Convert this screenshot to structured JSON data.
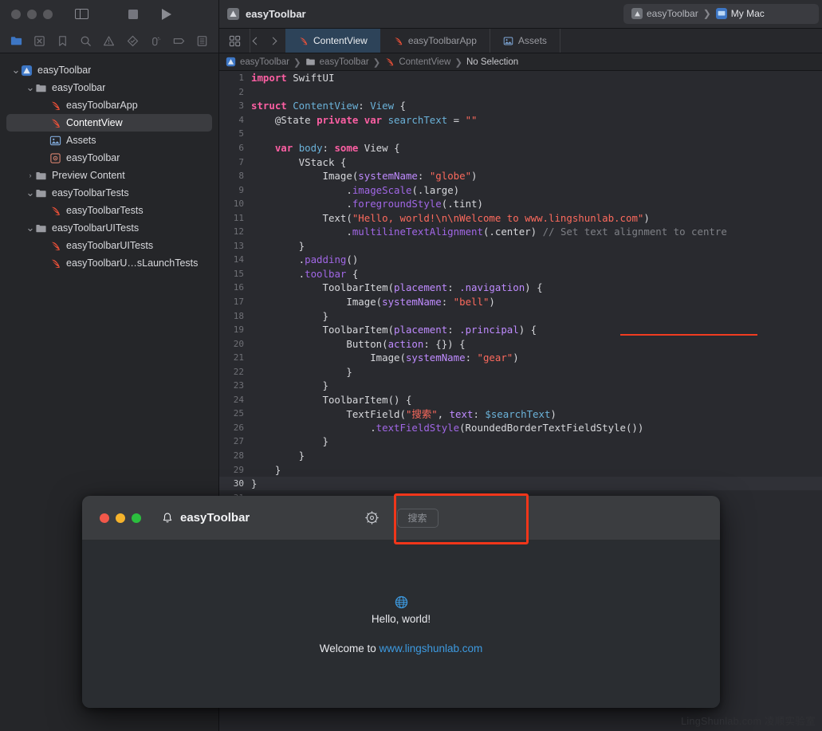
{
  "window": {
    "project_title": "easyToolbar",
    "project_icon": "xcode-app-icon",
    "sidebar_toggle_icon": "sidebar-toggle-icon",
    "stop_button_label": "stop-button",
    "run_button_label": "run-button",
    "traffic_lights": [
      "close",
      "minimize",
      "zoom"
    ]
  },
  "scheme": {
    "target": "easyToolbar",
    "separator": "❯",
    "destination": "My Mac"
  },
  "navigator_icons": [
    {
      "name": "project-navigator-icon",
      "active": true
    },
    {
      "name": "source-control-navigator-icon",
      "active": false
    },
    {
      "name": "bookmark-navigator-icon",
      "active": false
    },
    {
      "name": "find-navigator-icon",
      "active": false
    },
    {
      "name": "issue-navigator-icon",
      "active": false
    },
    {
      "name": "test-navigator-icon",
      "active": false
    },
    {
      "name": "debug-navigator-icon",
      "active": false
    },
    {
      "name": "breakpoint-navigator-icon",
      "active": false
    },
    {
      "name": "report-navigator-icon",
      "active": false
    }
  ],
  "sidebar": {
    "items": [
      {
        "label": "easyToolbar",
        "indent": 0,
        "twisty": "⌄",
        "icon": "xcode-project-icon",
        "selected": false
      },
      {
        "label": "easyToolbar",
        "indent": 1,
        "twisty": "⌄",
        "icon": "folder-icon",
        "selected": false
      },
      {
        "label": "easyToolbarApp",
        "indent": 2,
        "twisty": "",
        "icon": "swift-file-icon",
        "selected": false
      },
      {
        "label": "ContentView",
        "indent": 2,
        "twisty": "",
        "icon": "swift-file-icon",
        "selected": true
      },
      {
        "label": "Assets",
        "indent": 2,
        "twisty": "",
        "icon": "assets-catalog-icon",
        "selected": false
      },
      {
        "label": "easyToolbar",
        "indent": 2,
        "twisty": "",
        "icon": "entitlements-file-icon",
        "selected": false
      },
      {
        "label": "Preview Content",
        "indent": 1,
        "twisty": "›",
        "icon": "folder-icon",
        "selected": false
      },
      {
        "label": "easyToolbarTests",
        "indent": 1,
        "twisty": "⌄",
        "icon": "folder-icon",
        "selected": false
      },
      {
        "label": "easyToolbarTests",
        "indent": 2,
        "twisty": "",
        "icon": "swift-file-icon",
        "selected": false
      },
      {
        "label": "easyToolbarUITests",
        "indent": 1,
        "twisty": "⌄",
        "icon": "folder-icon",
        "selected": false
      },
      {
        "label": "easyToolbarUITests",
        "indent": 2,
        "twisty": "",
        "icon": "swift-file-icon",
        "selected": false
      },
      {
        "label": "easyToolbarU…sLaunchTests",
        "indent": 2,
        "twisty": "",
        "icon": "swift-file-icon",
        "selected": false
      }
    ]
  },
  "tabs": {
    "grid_icon": "tab-grid-icon",
    "back_icon": "chevron-left-icon",
    "forward_icon": "chevron-right-icon",
    "items": [
      {
        "label": "ContentView",
        "icon": "swift-file-icon",
        "active": true
      },
      {
        "label": "easyToolbarApp",
        "icon": "swift-file-icon",
        "active": false
      },
      {
        "label": "Assets",
        "icon": "assets-catalog-icon",
        "active": false
      }
    ]
  },
  "breadcrumb": {
    "items": [
      {
        "label": "easyToolbar",
        "icon": "xcode-project-icon"
      },
      {
        "label": "easyToolbar",
        "icon": "folder-icon"
      },
      {
        "label": "ContentView",
        "icon": "swift-file-icon"
      },
      {
        "label": "No Selection",
        "icon": ""
      }
    ],
    "separator": "❯"
  },
  "editor": {
    "annotation": {
      "type": "red-underline",
      "target_line": 19,
      "target_text": "placement: .principal"
    },
    "current_line": 30,
    "lines": [
      {
        "n": 1,
        "tokens": [
          {
            "t": "import ",
            "c": "kw"
          },
          {
            "t": "SwiftUI",
            "c": "pln"
          }
        ]
      },
      {
        "n": 2,
        "tokens": []
      },
      {
        "n": 3,
        "tokens": [
          {
            "t": "struct ",
            "c": "kw"
          },
          {
            "t": "ContentView",
            "c": "typ"
          },
          {
            "t": ": ",
            "c": "pln"
          },
          {
            "t": "View",
            "c": "typ"
          },
          {
            "t": " {",
            "c": "pln"
          }
        ]
      },
      {
        "n": 4,
        "tokens": [
          {
            "t": "    @State ",
            "c": "pln"
          },
          {
            "t": "private ",
            "c": "kw"
          },
          {
            "t": "var ",
            "c": "kw"
          },
          {
            "t": "searchText",
            "c": "var"
          },
          {
            "t": " = ",
            "c": "pln"
          },
          {
            "t": "\"\"",
            "c": "str"
          }
        ]
      },
      {
        "n": 5,
        "tokens": []
      },
      {
        "n": 6,
        "tokens": [
          {
            "t": "    ",
            "c": "pln"
          },
          {
            "t": "var ",
            "c": "kw"
          },
          {
            "t": "body",
            "c": "var"
          },
          {
            "t": ": ",
            "c": "pln"
          },
          {
            "t": "some ",
            "c": "kw"
          },
          {
            "t": "View",
            "c": "pln"
          },
          {
            "t": " {",
            "c": "pln"
          }
        ]
      },
      {
        "n": 7,
        "tokens": [
          {
            "t": "        VStack {",
            "c": "pln"
          }
        ]
      },
      {
        "n": 8,
        "tokens": [
          {
            "t": "            Image(",
            "c": "pln"
          },
          {
            "t": "systemName",
            "c": "prm"
          },
          {
            "t": ": ",
            "c": "pln"
          },
          {
            "t": "\"globe\"",
            "c": "str"
          },
          {
            "t": ")",
            "c": "pln"
          }
        ]
      },
      {
        "n": 9,
        "tokens": [
          {
            "t": "                .",
            "c": "pln"
          },
          {
            "t": "imageScale",
            "c": "mth"
          },
          {
            "t": "(.large)",
            "c": "pln"
          }
        ]
      },
      {
        "n": 10,
        "tokens": [
          {
            "t": "                .",
            "c": "pln"
          },
          {
            "t": "foregroundStyle",
            "c": "mth"
          },
          {
            "t": "(.tint)",
            "c": "pln"
          }
        ]
      },
      {
        "n": 11,
        "tokens": [
          {
            "t": "            Text(",
            "c": "pln"
          },
          {
            "t": "\"Hello, world!\\n\\nWelcome to www.lingshunlab.com\"",
            "c": "str"
          },
          {
            "t": ")",
            "c": "pln"
          }
        ]
      },
      {
        "n": 12,
        "tokens": [
          {
            "t": "                .",
            "c": "pln"
          },
          {
            "t": "multilineTextAlignment",
            "c": "mth"
          },
          {
            "t": "(.center) ",
            "c": "pln"
          },
          {
            "t": "// Set text alignment to centre",
            "c": "cmt"
          }
        ]
      },
      {
        "n": 13,
        "tokens": [
          {
            "t": "        }",
            "c": "pln"
          }
        ]
      },
      {
        "n": 14,
        "tokens": [
          {
            "t": "        .",
            "c": "pln"
          },
          {
            "t": "padding",
            "c": "mth"
          },
          {
            "t": "()",
            "c": "pln"
          }
        ]
      },
      {
        "n": 15,
        "tokens": [
          {
            "t": "        .",
            "c": "pln"
          },
          {
            "t": "toolbar",
            "c": "mth"
          },
          {
            "t": " {",
            "c": "pln"
          }
        ]
      },
      {
        "n": 16,
        "tokens": [
          {
            "t": "            ToolbarItem(",
            "c": "pln"
          },
          {
            "t": "placement",
            "c": "prm"
          },
          {
            "t": ": ",
            "c": "pln"
          },
          {
            "t": ".navigation",
            "c": "prm"
          },
          {
            "t": ") {",
            "c": "pln"
          }
        ]
      },
      {
        "n": 17,
        "tokens": [
          {
            "t": "                Image(",
            "c": "pln"
          },
          {
            "t": "systemName",
            "c": "prm"
          },
          {
            "t": ": ",
            "c": "pln"
          },
          {
            "t": "\"bell\"",
            "c": "str"
          },
          {
            "t": ")",
            "c": "pln"
          }
        ]
      },
      {
        "n": 18,
        "tokens": [
          {
            "t": "            }",
            "c": "pln"
          }
        ]
      },
      {
        "n": 19,
        "tokens": [
          {
            "t": "            ToolbarItem(",
            "c": "pln"
          },
          {
            "t": "placement",
            "c": "prm"
          },
          {
            "t": ": ",
            "c": "pln"
          },
          {
            "t": ".principal",
            "c": "prm"
          },
          {
            "t": ") {",
            "c": "pln"
          }
        ]
      },
      {
        "n": 20,
        "tokens": [
          {
            "t": "                Button(",
            "c": "pln"
          },
          {
            "t": "action",
            "c": "prm"
          },
          {
            "t": ": {}) {",
            "c": "pln"
          }
        ]
      },
      {
        "n": 21,
        "tokens": [
          {
            "t": "                    Image(",
            "c": "pln"
          },
          {
            "t": "systemName",
            "c": "prm"
          },
          {
            "t": ": ",
            "c": "pln"
          },
          {
            "t": "\"gear\"",
            "c": "str"
          },
          {
            "t": ")",
            "c": "pln"
          }
        ]
      },
      {
        "n": 22,
        "tokens": [
          {
            "t": "                }",
            "c": "pln"
          }
        ]
      },
      {
        "n": 23,
        "tokens": [
          {
            "t": "            }",
            "c": "pln"
          }
        ]
      },
      {
        "n": 24,
        "tokens": [
          {
            "t": "            ToolbarItem() {",
            "c": "pln"
          }
        ]
      },
      {
        "n": 25,
        "tokens": [
          {
            "t": "                TextField(",
            "c": "pln"
          },
          {
            "t": "\"搜索\"",
            "c": "str"
          },
          {
            "t": ", ",
            "c": "pln"
          },
          {
            "t": "text",
            "c": "prm"
          },
          {
            "t": ": ",
            "c": "pln"
          },
          {
            "t": "$searchText",
            "c": "var"
          },
          {
            "t": ")",
            "c": "pln"
          }
        ]
      },
      {
        "n": 26,
        "tokens": [
          {
            "t": "                    .",
            "c": "pln"
          },
          {
            "t": "textFieldStyle",
            "c": "mth"
          },
          {
            "t": "(RoundedBorderTextFieldStyle())",
            "c": "pln"
          }
        ]
      },
      {
        "n": 27,
        "tokens": [
          {
            "t": "            }",
            "c": "pln"
          }
        ]
      },
      {
        "n": 28,
        "tokens": [
          {
            "t": "        }",
            "c": "pln"
          }
        ]
      },
      {
        "n": 29,
        "tokens": [
          {
            "t": "    }",
            "c": "pln"
          }
        ]
      },
      {
        "n": 30,
        "tokens": [
          {
            "t": "}",
            "c": "pln"
          }
        ]
      },
      {
        "n": 31,
        "tokens": []
      }
    ]
  },
  "simulator": {
    "title": "easyToolbar",
    "bell_icon": "bell-icon",
    "gear_icon": "gear-icon",
    "search_placeholder": "搜索",
    "globe_icon": "globe-icon",
    "hello_text": "Hello, world!",
    "welcome_prefix": "Welcome to ",
    "welcome_link": "www.lingshunlab.com",
    "traffic_lights": [
      "close",
      "minimize",
      "zoom"
    ]
  },
  "watermark": "LingShunlab.com 凌顺实验室",
  "colors": {
    "accent_blue": "#3d9ae0",
    "annotation_red": "#f0361a",
    "active_tab_bg": "#2d4359",
    "editor_bg": "#292a2f",
    "sidebar_bg": "#252629",
    "string_color": "#fc6a5d",
    "keyword_color": "#fc5fa3",
    "method_color": "#a167e6"
  }
}
